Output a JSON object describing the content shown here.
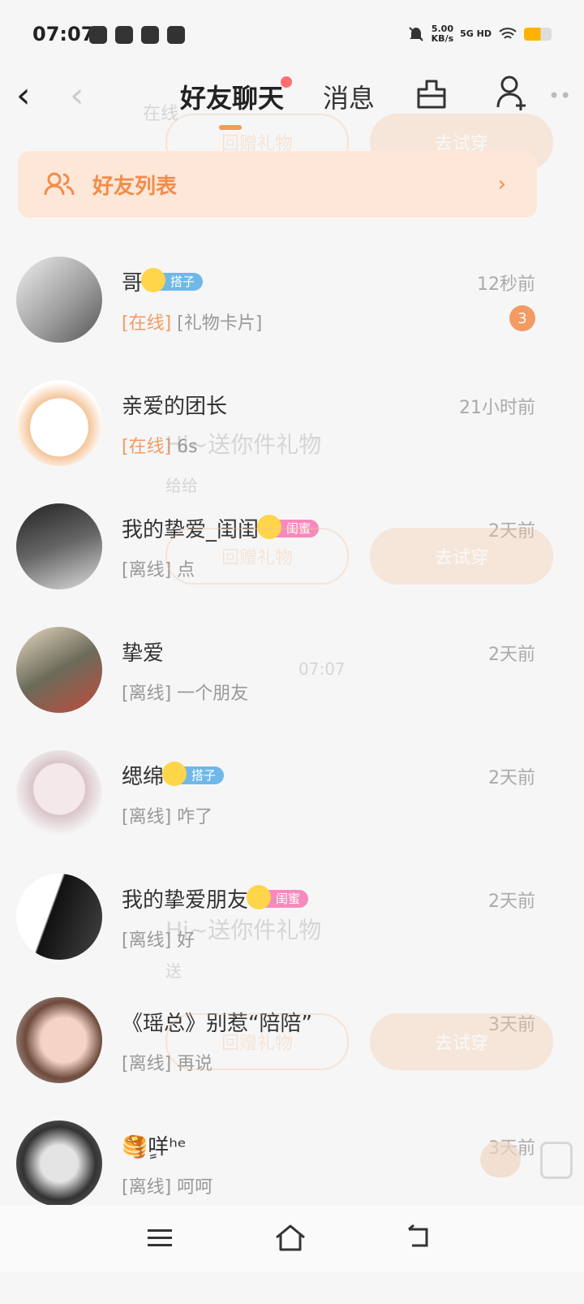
{
  "status_bar": {
    "time": "07:07",
    "net_speed": "5.00",
    "net_unit": "KB/s",
    "network": "5G HD"
  },
  "nav": {
    "tab_friends": "好友聊天",
    "tab_messages": "消息"
  },
  "banner": {
    "title": "好友列表",
    "arrow": "›"
  },
  "ghost": {
    "online": "在线",
    "return_gift": "回赠礼物",
    "try_on": "去试穿",
    "hi_gift": "Hi~送你件礼物",
    "give": "给给",
    "send": "送",
    "time": "07:07"
  },
  "friends": [
    {
      "name": "哥",
      "badge": "搭子",
      "badge_color": "#6fb8e8",
      "time": "12秒前",
      "status": "[在线]",
      "online": true,
      "msg": "[礼物卡片]",
      "unread": "3"
    },
    {
      "name": "亲爱的团长",
      "badge": "",
      "time": "21小时前",
      "status": "[在线]",
      "online": true,
      "msg": "6s",
      "unread": ""
    },
    {
      "name": "我的挚爱_闺闺",
      "badge": "闺蜜",
      "badge_color": "#f68abc",
      "time": "2天前",
      "status": "[离线]",
      "online": false,
      "msg": "点",
      "unread": ""
    },
    {
      "name": "挚爱",
      "badge": "",
      "time": "2天前",
      "status": "[离线]",
      "online": false,
      "msg": "一个朋友",
      "unread": ""
    },
    {
      "name": "缌绵",
      "badge": "搭子",
      "badge_color": "#6fb8e8",
      "time": "2天前",
      "status": "[离线]",
      "online": false,
      "msg": "咋了",
      "unread": ""
    },
    {
      "name": "我的挚爱朋友",
      "badge": "闺蜜",
      "badge_color": "#f68abc",
      "time": "2天前",
      "status": "[离线]",
      "online": false,
      "msg": "好",
      "unread": ""
    },
    {
      "name": "《瑶总》别惹“陪陪”",
      "badge": "",
      "time": "3天前",
      "status": "[离线]",
      "online": false,
      "msg": "再说",
      "unread": ""
    },
    {
      "name": "🥞ٍ咩ʰᵉ",
      "badge": "",
      "time": "3天前",
      "status": "[离线]",
      "online": false,
      "msg": "呵呵",
      "unread": ""
    }
  ]
}
